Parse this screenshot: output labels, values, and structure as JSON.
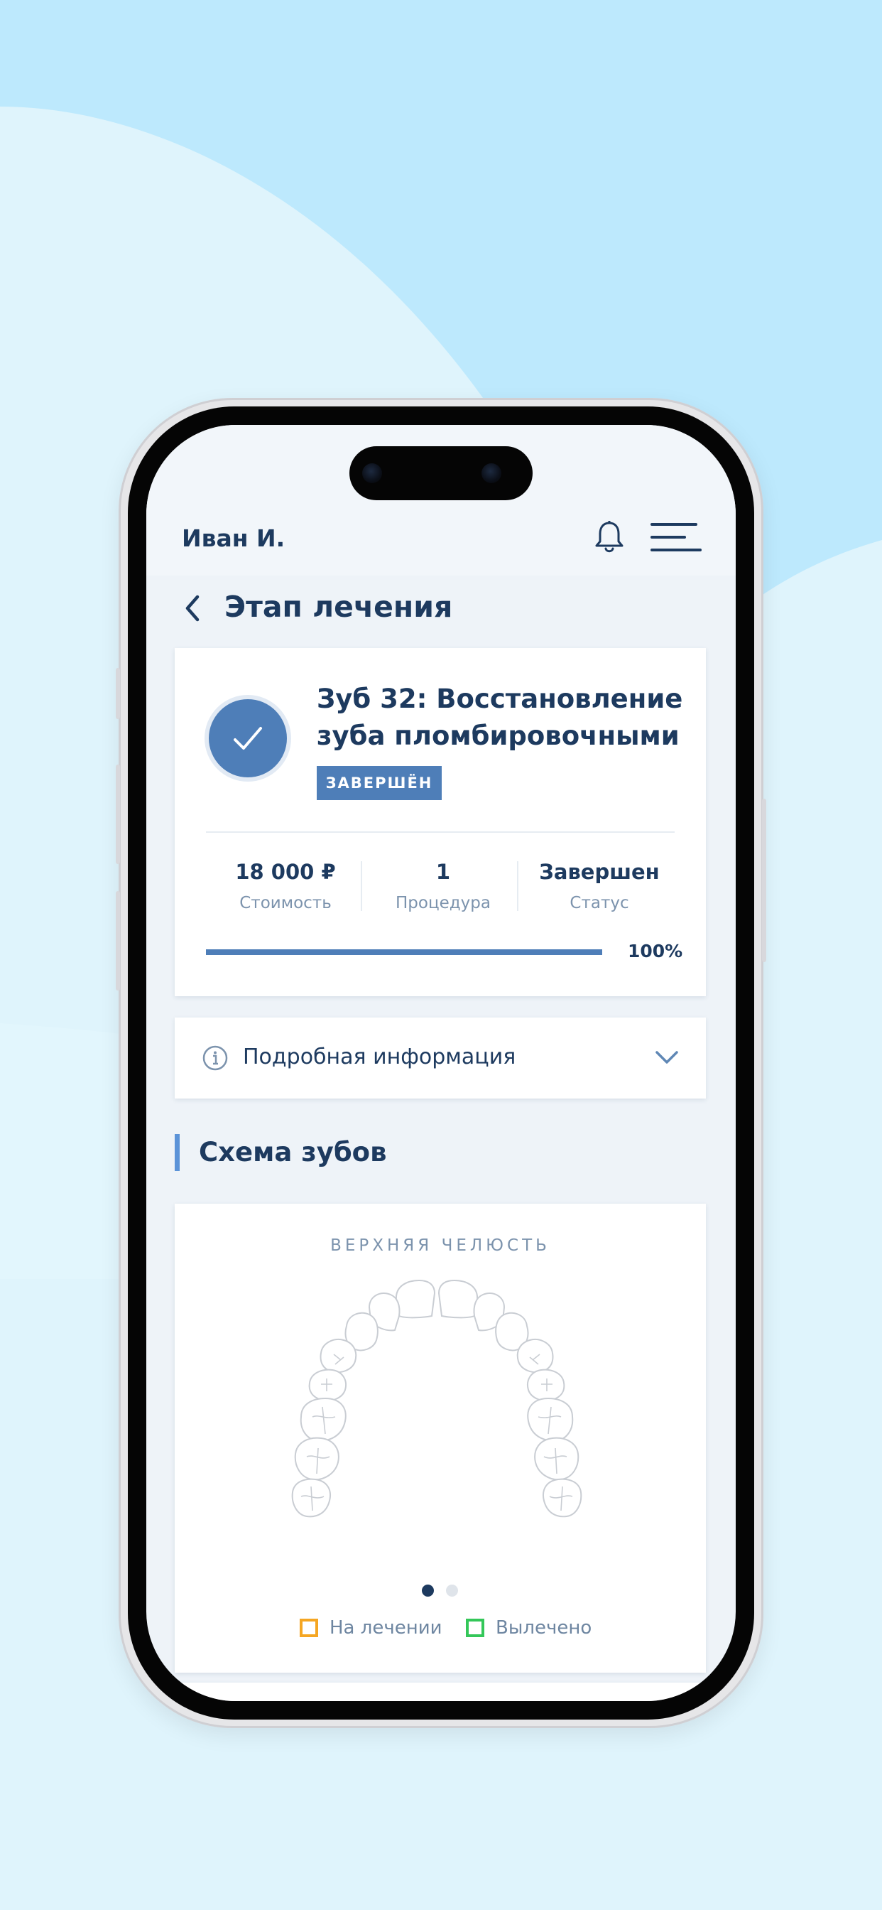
{
  "header": {
    "user_name": "Иван И.",
    "icons": [
      "bell-icon",
      "hamburger-menu-icon"
    ]
  },
  "page": {
    "title": "Этап лечения",
    "back_icon": "chevron-left-icon"
  },
  "treatment": {
    "title": "Зуб 32: Восстановление зуба пломбировочными ...",
    "badge": "ЗАВЕРШЁН",
    "status_icon": "check-icon",
    "stats": [
      {
        "value": "18 000 ₽",
        "label": "Стоимость"
      },
      {
        "value": "1",
        "label": "Процедура"
      },
      {
        "value": "Завершен",
        "label": "Статус"
      }
    ],
    "progress_percent": 100,
    "progress_text": "100%"
  },
  "details": {
    "label": "Подробная информация",
    "icon": "info-icon",
    "expand_icon": "chevron-down-icon"
  },
  "teeth_scheme": {
    "section_title": "Схема зубов",
    "jaw_label": "ВЕРХНЯЯ ЧЕЛЮСТЬ",
    "pager": {
      "count": 2,
      "active": 1
    },
    "legend": [
      {
        "label": "На лечении",
        "color": "#f5a623"
      },
      {
        "label": "Вылечено",
        "color": "#34c759"
      }
    ]
  },
  "colors": {
    "accent": "#4e7eb8",
    "text_primary": "#1d3a5f",
    "text_secondary": "#7c93ad",
    "background": "#eef3f8",
    "section_marker": "#5b93d8"
  }
}
